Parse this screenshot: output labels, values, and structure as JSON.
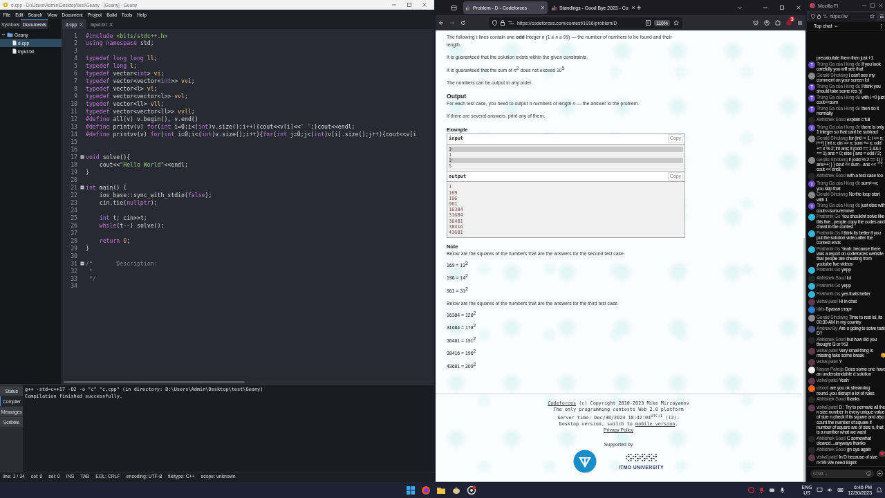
{
  "geany": {
    "title": "d.cpp - D:\\Users\\Admin\\Desktop\\test\\Geany - [Geany] - Geany",
    "menu": [
      "File",
      "Edit",
      "Search",
      "View",
      "Document",
      "Project",
      "Build",
      "Tools",
      "Help"
    ],
    "sidebar_tabs": [
      {
        "label": "Symbols",
        "selected": false
      },
      {
        "label": "Documents",
        "selected": true
      }
    ],
    "tree": [
      {
        "label": "Geany",
        "expanded": true,
        "selected": false,
        "children": [
          {
            "label": "d.cpp",
            "selected": true
          },
          {
            "label": "input.txt",
            "selected": false
          }
        ]
      }
    ],
    "editor_tabs": [
      {
        "label": "d.cpp",
        "selected": true
      },
      {
        "label": "input.txt",
        "selected": false
      }
    ],
    "code_lines": [
      {
        "n": "1",
        "fold": false,
        "tokens": [
          {
            "kind": "pp",
            "text": "#include "
          },
          {
            "kind": "str",
            "text": "<bits/stdc++.h>"
          }
        ]
      },
      {
        "n": "2",
        "fold": false,
        "tokens": [
          {
            "kind": "kw",
            "text": "using namespace "
          },
          {
            "kind": "pl",
            "text": "std;"
          }
        ]
      },
      {
        "n": "3",
        "fold": false
      },
      {
        "n": "4",
        "fold": false,
        "tokens": [
          {
            "kind": "kw",
            "text": "typedef "
          },
          {
            "kind": "ty",
            "text": "long long "
          },
          {
            "kind": "id",
            "text": "ll"
          },
          {
            "kind": "pl",
            "text": ";"
          }
        ]
      },
      {
        "n": "5",
        "fold": false,
        "tokens": [
          {
            "kind": "kw",
            "text": "typedef "
          },
          {
            "kind": "ty",
            "text": "long "
          },
          {
            "kind": "id",
            "text": "l"
          },
          {
            "kind": "pl",
            "text": ";"
          }
        ]
      },
      {
        "n": "6",
        "fold": false,
        "tokens": [
          {
            "kind": "kw",
            "text": "typedef "
          },
          {
            "kind": "pl",
            "text": "vector<"
          },
          {
            "kind": "ty",
            "text": "int"
          },
          {
            "kind": "pl",
            "text": "> "
          },
          {
            "kind": "id",
            "text": "vi"
          },
          {
            "kind": "pl",
            "text": ";"
          }
        ]
      },
      {
        "n": "7",
        "fold": false,
        "tokens": [
          {
            "kind": "kw",
            "text": "typedef "
          },
          {
            "kind": "pl",
            "text": "vector<vector<"
          },
          {
            "kind": "ty",
            "text": "int"
          },
          {
            "kind": "pl",
            "text": ">> "
          },
          {
            "kind": "id",
            "text": "vvi"
          },
          {
            "kind": "pl",
            "text": ";"
          }
        ]
      },
      {
        "n": "8",
        "fold": false,
        "tokens": [
          {
            "kind": "kw",
            "text": "typedef "
          },
          {
            "kind": "pl",
            "text": "vector<l> "
          },
          {
            "kind": "id",
            "text": "vl"
          },
          {
            "kind": "pl",
            "text": ";"
          }
        ]
      },
      {
        "n": "9",
        "fold": false,
        "tokens": [
          {
            "kind": "kw",
            "text": "typedef "
          },
          {
            "kind": "pl",
            "text": "vector<vector<l>> "
          },
          {
            "kind": "id",
            "text": "vvl"
          },
          {
            "kind": "pl",
            "text": ";"
          }
        ]
      },
      {
        "n": "10",
        "fold": false,
        "tokens": [
          {
            "kind": "kw",
            "text": "typedef "
          },
          {
            "kind": "pl",
            "text": "vector<ll> "
          },
          {
            "kind": "id",
            "text": "vll"
          },
          {
            "kind": "pl",
            "text": ";"
          }
        ]
      },
      {
        "n": "11",
        "fold": false,
        "tokens": [
          {
            "kind": "kw",
            "text": "typedef "
          },
          {
            "kind": "pl",
            "text": "vector<vector<ll>> "
          },
          {
            "kind": "id",
            "text": "vvll"
          },
          {
            "kind": "pl",
            "text": ";"
          }
        ]
      },
      {
        "n": "12",
        "fold": false,
        "tokens": [
          {
            "kind": "pp",
            "text": "#define "
          },
          {
            "kind": "pl",
            "text": "all(v) v.begin(), v.end()"
          }
        ]
      },
      {
        "n": "13",
        "fold": false,
        "tokens": [
          {
            "kind": "pp",
            "text": "#define "
          },
          {
            "kind": "pl",
            "text": "printv(v) "
          },
          {
            "kind": "kw",
            "text": "for"
          },
          {
            "kind": "pl",
            "text": "("
          },
          {
            "kind": "ty",
            "text": "int"
          },
          {
            "kind": "pl",
            "text": " i=0;i<("
          },
          {
            "kind": "ty",
            "text": "int"
          },
          {
            "kind": "pl",
            "text": ")v.size();i++){cout<<v[i]<<"
          },
          {
            "kind": "str",
            "text": "' '"
          },
          {
            "kind": "pl",
            "text": ";}cout<<endl;"
          }
        ]
      },
      {
        "n": "14",
        "fold": false,
        "tokens": [
          {
            "kind": "pp",
            "text": "#define "
          },
          {
            "kind": "pl",
            "text": "printvv(v) "
          },
          {
            "kind": "kw",
            "text": "for"
          },
          {
            "kind": "pl",
            "text": "("
          },
          {
            "kind": "ty",
            "text": "int"
          },
          {
            "kind": "pl",
            "text": " i=0;i<("
          },
          {
            "kind": "ty",
            "text": "int"
          },
          {
            "kind": "pl",
            "text": ")v.size();i++){"
          },
          {
            "kind": "kw",
            "text": "for"
          },
          {
            "kind": "pl",
            "text": "("
          },
          {
            "kind": "ty",
            "text": "int"
          },
          {
            "kind": "pl",
            "text": " j=0;j<("
          },
          {
            "kind": "ty",
            "text": "int"
          },
          {
            "kind": "pl",
            "text": ")v[i].size();j++){cout<<v[i"
          }
        ]
      },
      {
        "n": "15",
        "fold": false
      },
      {
        "n": "16",
        "fold": false
      },
      {
        "n": "17",
        "fold": true,
        "tokens": [
          {
            "kind": "ty",
            "text": "void"
          },
          {
            "kind": "pl",
            "text": " solve(){"
          }
        ]
      },
      {
        "n": "18",
        "fold": false,
        "tokens": [
          {
            "kind": "pl",
            "text": "    cout<<"
          },
          {
            "kind": "str",
            "text": "\"Hello World\""
          },
          {
            "kind": "pl",
            "text": "<<endl;"
          }
        ]
      },
      {
        "n": "19",
        "fold": false,
        "tokens": [
          {
            "kind": "pl",
            "text": "}"
          }
        ]
      },
      {
        "n": "20",
        "fold": false
      },
      {
        "n": "21",
        "fold": true,
        "tokens": [
          {
            "kind": "ty",
            "text": "int"
          },
          {
            "kind": "pl",
            "text": " main() {"
          }
        ]
      },
      {
        "n": "22",
        "fold": false,
        "tokens": [
          {
            "kind": "pl",
            "text": "    ios_base::sync_with_stdio("
          },
          {
            "kind": "kw",
            "text": "false"
          },
          {
            "kind": "pl",
            "text": ");"
          }
        ]
      },
      {
        "n": "23",
        "fold": false,
        "tokens": [
          {
            "kind": "pl",
            "text": "    cin.tie("
          },
          {
            "kind": "kw",
            "text": "nullptr"
          },
          {
            "kind": "pl",
            "text": ");"
          }
        ]
      },
      {
        "n": "24",
        "fold": false
      },
      {
        "n": "25",
        "fold": false,
        "tokens": [
          {
            "kind": "ty",
            "text": "    int"
          },
          {
            "kind": "pl",
            "text": " t; cin>>t;"
          }
        ]
      },
      {
        "n": "26",
        "fold": false,
        "tokens": [
          {
            "kind": "kw",
            "text": "    while"
          },
          {
            "kind": "pl",
            "text": "(t--) solve();"
          }
        ]
      },
      {
        "n": "27",
        "fold": false
      },
      {
        "n": "28",
        "fold": false,
        "tokens": [
          {
            "kind": "kw",
            "text": "    return "
          },
          {
            "kind": "num",
            "text": "0"
          },
          {
            "kind": "pl",
            "text": ";"
          }
        ]
      },
      {
        "n": "29",
        "fold": false,
        "tokens": [
          {
            "kind": "pl",
            "text": "}"
          }
        ]
      },
      {
        "n": "30",
        "fold": false
      },
      {
        "n": "31",
        "fold": true,
        "tokens": [
          {
            "kind": "com",
            "text": "/*       Description:"
          }
        ]
      },
      {
        "n": "32",
        "fold": false,
        "tokens": [
          {
            "kind": "com",
            "text": " *"
          }
        ]
      },
      {
        "n": "33",
        "fold": false,
        "tokens": [
          {
            "kind": "com",
            "text": " */"
          }
        ]
      },
      {
        "n": "34",
        "fold": false
      }
    ],
    "panel_tabs": [
      {
        "label": "Status",
        "selected": false
      },
      {
        "label": "Compiler",
        "selected": true
      },
      {
        "label": "Messages",
        "selected": false
      },
      {
        "label": "Scribble",
        "selected": false
      }
    ],
    "compiler_output": [
      "g++ -std=c++17 -O2 -o \"c\" \"c.cpp\" (in directory: D:\\Users\\Admin\\Desktop\\test\\Geany)",
      "Compilation finished successfully."
    ],
    "status_bar": [
      "line: 1 / 34",
      "col: 0",
      "sel: 0",
      "INS",
      "TAB",
      "EOL: CRLF",
      "encoding: UTF-8",
      "filetype: C++",
      "scope: unknown"
    ]
  },
  "browser": {
    "tabs": [
      {
        "label": "Problem - D - Codeforces",
        "selected": true
      },
      {
        "label": "Standings - Good Bye 2023 - Co",
        "selected": false
      }
    ],
    "url": "https://codeforces.com/contest/1916/problem/D",
    "zoom": "110%",
    "extension_badge": "3",
    "statement": [
      "The following *t* lines contain one **odd** integer *n* (1 ≤ *n* ≤ 99) — the number of numbers to be found and their length.",
      "It is guaranteed that the solution exists within the given constraints.",
      "It is guaranteed that the sum of *n*$^{2}$ does not exceed 10$^{5}$",
      "The numbers can be output in any order."
    ],
    "output_heading": "Output",
    "output_paras": [
      "For each test case, you need to output *n* numbers of length *n* — the answer to the problem.",
      "If there are several answers, print any of them."
    ],
    "example": {
      "title": "Example",
      "input_label": "input",
      "input_copy": "Copy",
      "input_lines": [
        {
          "text": "3",
          "highlighted": true
        },
        {
          "text": "1",
          "highlighted": false
        },
        {
          "text": "3",
          "highlighted": true
        },
        {
          "text": "5",
          "highlighted": false
        }
      ],
      "output_label": "output",
      "output_copy": "Copy",
      "output_lines": [
        "1",
        "169",
        "196",
        "961",
        "16384",
        "31684",
        "36481",
        "38416",
        "43681"
      ]
    },
    "note": {
      "title": "Note",
      "blocks": [
        {
          "kind": "text",
          "text": "Below are the squares of the numbers that are the answers for the second test case."
        },
        {
          "kind": "equation",
          "text": "169 = 13$^{2}$"
        },
        {
          "kind": "equation",
          "text": "196 = 14$^{2}$"
        },
        {
          "kind": "equation",
          "text": "961 = 31$^{2}$"
        },
        {
          "kind": "text",
          "text": "Below are the squares of the numbers that are the answers for the third test case."
        },
        {
          "kind": "equation",
          "text": "16384 = 128$^{2}$"
        },
        {
          "kind": "equation",
          "text": "31684 = 178$^{2}$"
        },
        {
          "kind": "equation",
          "text": "36481 = 191$^{2}$"
        },
        {
          "kind": "equation",
          "text": "38416 = 196$^{2}$"
        },
        {
          "kind": "equation",
          "text": "43681 = 209$^{2}$"
        }
      ]
    },
    "footer": {
      "copyright_link": "Codeforces",
      "copyright": "(c) Copyright 2010-2023 Mike Mirzayanov",
      "platform": "The only programming contests Web 2.0 platform",
      "server_time": "Server time: Dec/30/2023 18:42:04$^{UTC+1}$ (l2).",
      "version_text": "Desktop version, switch to",
      "version_link": "mobile version",
      "version_end": ".",
      "privacy": "Privacy Policy",
      "supported_by": "Supported by",
      "sponsor": "ITMO UNIVERSITY"
    }
  },
  "chat": {
    "window_title": "Mozilla Fi",
    "url": "https://w",
    "title": "Top chat",
    "input_placeholder": "Chat...",
    "messages": [
      {
        "kind": "cut-off",
        "text": "precalculate them then just +1"
      },
      {
        "kind": "message",
        "author": "Trúng Ga của Hùng đề",
        "initial": "T",
        "text": "If you look carefully you will see that",
        "color": "#6b4fc4"
      },
      {
        "kind": "message",
        "author": "Gerald Sihotang",
        "text": "I can't see my comment on your screen lol",
        "color": "#8a8a8a"
      },
      {
        "kind": "message",
        "author": "Trúng Ga của Hùng đề",
        "initial": "T",
        "text": "I think you should take some res :))",
        "color": "#6b4fc4"
      },
      {
        "kind": "message",
        "author": "Trúng Ga của Hùng đề",
        "initial": "T",
        "text": "with i =0 just cout<<sum",
        "color": "#6b4fc4"
      },
      {
        "kind": "message",
        "author": "Trúng Ga của Hùng đề",
        "initial": "T",
        "text": "then do it normally",
        "color": "#6b4fc4"
      },
      {
        "kind": "message",
        "author": "Abhishek Sood",
        "text": "explain c full",
        "color": "#262626"
      },
      {
        "kind": "message",
        "author": "Trúng Ga của Hùng đề",
        "initial": "T",
        "text": "there is only 1 integer so that cant be subtract",
        "color": "#6b4fc4"
      },
      {
        "kind": "message",
        "author": "Gerald Sihotang",
        "text": "for (int i = 1; i <= n; i++) { int x; cin >> x; sum += x; odd += x % 2; int ans; if (odd == 1 && i == 1) ans = 0; else { ans = odd / 2;",
        "color": "#8a8a8a"
      },
      {
        "kind": "message",
        "author": "Gerald Sihotang",
        "text": "if (odd % 2 == 1) { ans++; } } cout << sum - ans << \" \"; cout << endl;",
        "color": "#8a8a8a"
      },
      {
        "kind": "message",
        "author": "Abhishek Sood",
        "text": "with a test case too",
        "color": "#262626"
      },
      {
        "kind": "message",
        "author": "Trúng Ga của Hùng đề",
        "initial": "T",
        "text": "sum+=x; you skip that",
        "color": "#6b4fc4"
      },
      {
        "kind": "message",
        "author": "Gerald Sihotang",
        "text": "No the loop start with 1",
        "color": "#8a8a8a"
      },
      {
        "kind": "message",
        "author": "Trúng Ga của Hùng đề",
        "initial": "T",
        "text": "just else with cout<<sum-remove",
        "color": "#6b4fc4"
      },
      {
        "kind": "message",
        "author": "Prathmik Gs",
        "text": "You shouldnt solve like this live , people copy the codes and cheat in the contest",
        "color": "#38b4d8"
      },
      {
        "kind": "message",
        "author": "Prathmik Gs",
        "text": "I think its better if you put the solution video after the contest ends",
        "color": "#38b4d8"
      },
      {
        "kind": "message",
        "author": "Prathmik Gs",
        "text": "Yeah, because there was a report on codeforces website that people are cheating from youtube live videos",
        "color": "#38b4d8"
      },
      {
        "kind": "message",
        "author": "Prathmik Gs",
        "text": "yepp",
        "color": "#38b4d8"
      },
      {
        "kind": "message",
        "author": "Abhishek Sood",
        "text": "lol",
        "color": "#262626"
      },
      {
        "kind": "message",
        "author": "Prathmik Gs",
        "text": "yepp",
        "color": "#38b4d8"
      },
      {
        "kind": "message",
        "author": "Prathmik Gs",
        "text": "yes thats better",
        "color": "#38b4d8"
      },
      {
        "kind": "message",
        "author": "vishal patel",
        "text": "Hi in chat",
        "color": "#5e3a4c"
      },
      {
        "kind": "message",
        "author": "Idris",
        "text": "Братан старт",
        "color": "#2f7fd0"
      },
      {
        "kind": "message",
        "author": "Gerald Sihotang",
        "text": "Time to rest lol, its 00:30 AM in my country",
        "color": "#8a8a8a"
      },
      {
        "kind": "message",
        "author": "Andrew By",
        "text": "Are u going to solve task D?",
        "color": "#4a5a8c"
      },
      {
        "kind": "message",
        "author": "Abhishek Sood",
        "text": "but how did you thought /3 or %3",
        "color": "#262626"
      },
      {
        "kind": "message-emoji",
        "author": "vishal patel",
        "text": "Very small thing is missing take some break",
        "color": "#5e3a4c"
      },
      {
        "kind": "message",
        "author": "vishal patel",
        "text": "Y",
        "color": "#5e3a4c"
      },
      {
        "kind": "message",
        "author": "Nayan Pahuja",
        "text": "Does some one have an understandable d solution",
        "color": "#f0f0f0"
      },
      {
        "kind": "message",
        "author": "vishal patel",
        "text": "Yeah",
        "color": "#5e3a4c"
      },
      {
        "kind": "message",
        "author": "ctrxxxl",
        "text": "are you ok streaming round..you disrupt a lot of rules",
        "color": "#e0691f"
      },
      {
        "kind": "message",
        "author": "Abhishek Sood",
        "text": "thanks",
        "color": "#262626"
      },
      {
        "kind": "message",
        "author": "vishal patel",
        "text": "D : Try to permute all the n size number in every unique value of size n check if its square and also count the number of square if number of square are of size n, that is a number what we want",
        "color": "#5e3a4c"
      },
      {
        "kind": "message",
        "author": "Abhishek Sood",
        "text": "C somewhat cleared....anyways thanks",
        "color": "#262626"
      },
      {
        "kind": "message",
        "author": "Abhishek Sood",
        "text": "gn cya again",
        "color": "#262626"
      },
      {
        "kind": "message",
        "author": "vishal patel",
        "text": "In D because of size n<99 We need Bigint",
        "color": "#5e3a4c"
      }
    ]
  },
  "taskbar": {
    "language": "ENG",
    "region": "US",
    "time": "6:46 PM",
    "date": "12/30/2023"
  }
}
